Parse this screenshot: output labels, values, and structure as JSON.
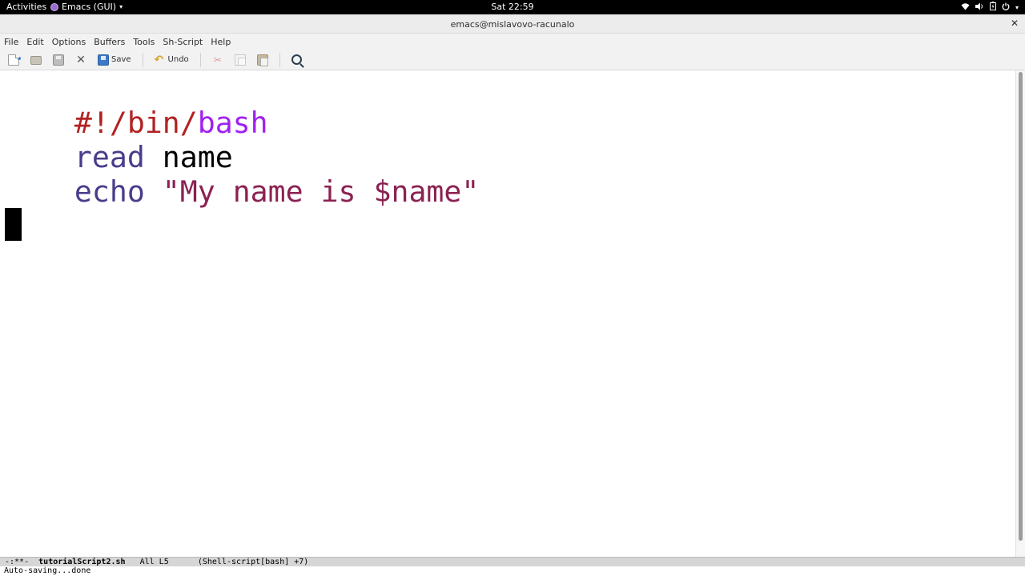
{
  "topbar": {
    "activities": "Activities",
    "app_name": "Emacs (GUI)",
    "clock": "Sat 22:59",
    "tray_icons": [
      "wifi-icon",
      "volume-icon",
      "battery-icon",
      "power-icon"
    ]
  },
  "window": {
    "title": "emacs@mislavovo-racunalo",
    "close_label": "✕"
  },
  "menubar": {
    "items": [
      "File",
      "Edit",
      "Options",
      "Buffers",
      "Tools",
      "Sh-Script",
      "Help"
    ]
  },
  "toolbar": {
    "save_label": "Save",
    "undo_label": "Undo",
    "icons": [
      "new-file-icon",
      "open-folder-icon",
      "save-disk-icon",
      "close-buffer-icon",
      "save-icon",
      "undo-icon",
      "cut-icon",
      "copy-icon",
      "paste-icon",
      "search-icon"
    ]
  },
  "editor": {
    "lines": [
      [
        {
          "text": "#!/bin/",
          "kind": "shebang"
        },
        {
          "text": "bash",
          "kind": "shebang-bash"
        }
      ],
      [
        {
          "text": "read",
          "kind": "builtin"
        },
        {
          "text": " name",
          "kind": "plain"
        }
      ],
      [
        {
          "text": "echo",
          "kind": "builtin"
        },
        {
          "text": " ",
          "kind": "plain"
        },
        {
          "text": "\"My name is ",
          "kind": "string"
        },
        {
          "text": "$name",
          "kind": "string"
        },
        {
          "text": "\"",
          "kind": "string"
        }
      ],
      [],
      []
    ],
    "cursor_line": 5
  },
  "modeline": {
    "status": "-:**-",
    "buffer_name": "tutorialScript2.sh",
    "position": "All L5",
    "mode": "(Shell-script[bash] +7)"
  },
  "echo_area": {
    "message": "Auto-saving...done"
  },
  "colors": {
    "shebang": "#b22222",
    "builtin": "#483d8b",
    "string": "#8b2252",
    "topbar_bg": "#000000"
  }
}
